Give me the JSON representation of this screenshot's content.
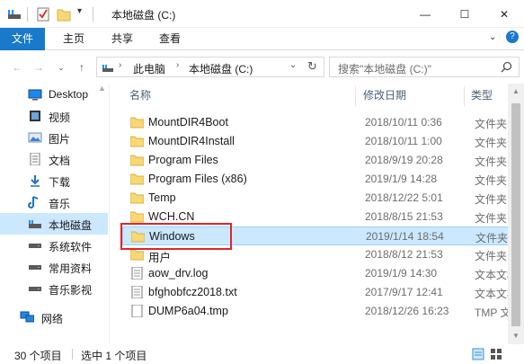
{
  "window": {
    "title": "本地磁盘 (C:)",
    "minimize_glyph": "—",
    "maximize_glyph": "☐",
    "close_glyph": "✕"
  },
  "ribbon": {
    "tabs": [
      "文件",
      "主页",
      "共享",
      "查看"
    ]
  },
  "address": {
    "path": [
      "此电脑",
      "本地磁盘 (C:)"
    ],
    "search_placeholder": "搜索\"本地磁盘 (C:)\""
  },
  "nav": {
    "items": [
      {
        "label": "Desktop",
        "icon": "desktop-icon"
      },
      {
        "label": "视频",
        "icon": "video-icon"
      },
      {
        "label": "图片",
        "icon": "pictures-icon"
      },
      {
        "label": "文档",
        "icon": "documents-icon"
      },
      {
        "label": "下载",
        "icon": "download-icon"
      },
      {
        "label": "音乐",
        "icon": "music-icon"
      },
      {
        "label": "本地磁盘",
        "icon": "drive-icon",
        "selected": true
      },
      {
        "label": "系统软件",
        "icon": "drive-icon"
      },
      {
        "label": "常用资料",
        "icon": "drive-icon"
      },
      {
        "label": "音乐影视",
        "icon": "drive-icon"
      },
      {
        "label": "网络",
        "icon": "network-icon"
      }
    ]
  },
  "list": {
    "columns": {
      "name": "名称",
      "date": "修改日期",
      "type": "类型"
    },
    "files": [
      {
        "name": "MountDIR4Boot",
        "date": "2018/10/11 0:36",
        "type": "文件夹",
        "kind": "folder"
      },
      {
        "name": "MountDIR4Install",
        "date": "2018/10/11 1:00",
        "type": "文件夹",
        "kind": "folder"
      },
      {
        "name": "Program Files",
        "date": "2018/9/19 20:28",
        "type": "文件夹",
        "kind": "folder"
      },
      {
        "name": "Program Files (x86)",
        "date": "2019/1/9 14:28",
        "type": "文件夹",
        "kind": "folder"
      },
      {
        "name": "Temp",
        "date": "2018/12/22 5:01",
        "type": "文件夹",
        "kind": "folder"
      },
      {
        "name": "WCH.CN",
        "date": "2018/8/15 21:53",
        "type": "文件夹",
        "kind": "folder"
      },
      {
        "name": "Windows",
        "date": "2019/1/14 18:54",
        "type": "文件夹",
        "kind": "folder",
        "selected": true
      },
      {
        "name": "用户",
        "date": "2018/8/12 21:53",
        "type": "文件夹",
        "kind": "folder"
      },
      {
        "name": "aow_drv.log",
        "date": "2019/1/9 14:30",
        "type": "文本文档",
        "kind": "doc"
      },
      {
        "name": "bfghobfcz2018.txt",
        "date": "2017/9/17 12:41",
        "type": "文本文档",
        "kind": "doc"
      },
      {
        "name": "DUMP6a04.tmp",
        "date": "2018/12/26 16:23",
        "type": "TMP 文件",
        "kind": "doc"
      }
    ]
  },
  "status": {
    "count": "30 个项目",
    "selected": "选中 1 个项目"
  },
  "colors": {
    "accent": "#1979ca",
    "selection": "#cce8ff",
    "highlight_box": "#e0252b",
    "folder": "#f8d775"
  }
}
